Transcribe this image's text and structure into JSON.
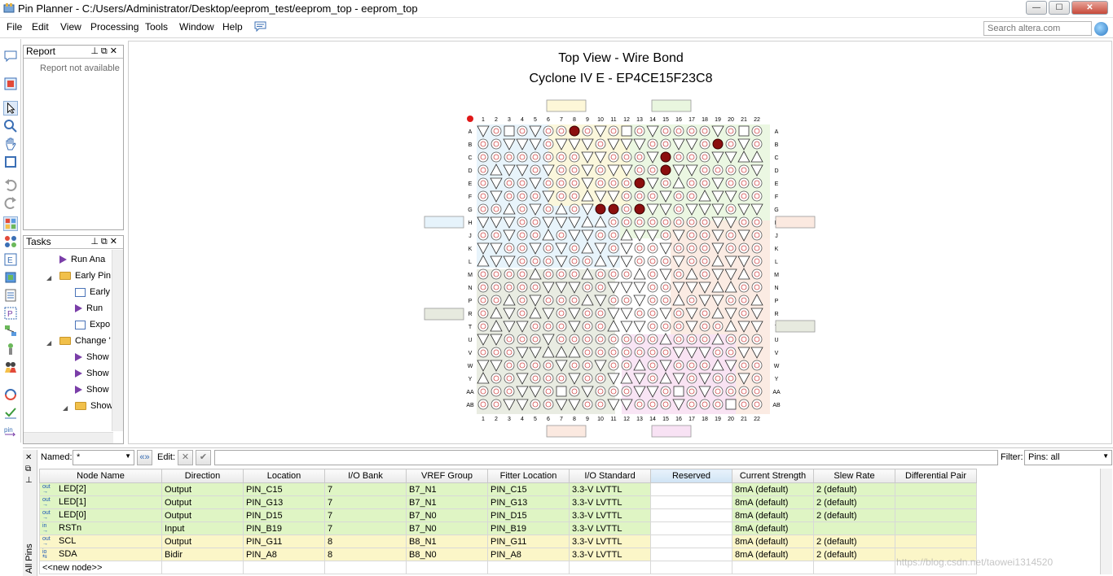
{
  "window": {
    "title": "Pin Planner - C:/Users/Administrator/Desktop/eeprom_test/eeprom_top - eeprom_top"
  },
  "menu": [
    "File",
    "Edit",
    "View",
    "Processing",
    "Tools",
    "Window",
    "Help"
  ],
  "search": {
    "placeholder": "Search altera.com"
  },
  "report_panel": {
    "title": "Report",
    "empty_text": "Report not available"
  },
  "tasks_panel": {
    "title": "Tasks",
    "items": [
      "Run Ana",
      "Early Pin",
      "Early",
      "Run",
      "Expo",
      "Change '",
      "Show",
      "Show",
      "Show",
      "Show"
    ]
  },
  "package_view": {
    "title": "Top View - Wire Bond",
    "subtitle": "Cyclone IV E - EP4CE15F23C8",
    "columns": [
      "1",
      "2",
      "3",
      "4",
      "5",
      "6",
      "7",
      "8",
      "9",
      "10",
      "11",
      "12",
      "13",
      "14",
      "15",
      "16",
      "17",
      "18",
      "19",
      "20",
      "21",
      "22"
    ],
    "rows": [
      "A",
      "B",
      "C",
      "D",
      "E",
      "F",
      "G",
      "H",
      "J",
      "K",
      "L",
      "M",
      "N",
      "P",
      "R",
      "T",
      "U",
      "V",
      "W",
      "Y",
      "AA",
      "AB"
    ]
  },
  "filter_bar": {
    "named_label": "Named:",
    "named_value": "*",
    "edit_label": "Edit:",
    "filter_label": "Filter:",
    "filter_value": "Pins: all"
  },
  "side_tab": {
    "label": "All Pins"
  },
  "pin_table": {
    "columns": [
      "Node Name",
      "Direction",
      "Location",
      "I/O Bank",
      "VREF Group",
      "Fitter Location",
      "I/O Standard",
      "Reserved",
      "Current Strength",
      "Slew Rate",
      "Differential Pair"
    ],
    "rows": [
      {
        "type": "out",
        "name": "LED[2]",
        "direction": "Output",
        "location": "PIN_C15",
        "bank": "7",
        "vref": "B7_N1",
        "fitter": "PIN_C15",
        "standard": "3.3-V LVTTL",
        "reserved": "",
        "current": "8mA (default)",
        "slew": "2 (default)",
        "diff": ""
      },
      {
        "type": "out",
        "name": "LED[1]",
        "direction": "Output",
        "location": "PIN_G13",
        "bank": "7",
        "vref": "B7_N1",
        "fitter": "PIN_G13",
        "standard": "3.3-V LVTTL",
        "reserved": "",
        "current": "8mA (default)",
        "slew": "2 (default)",
        "diff": ""
      },
      {
        "type": "out",
        "name": "LED[0]",
        "direction": "Output",
        "location": "PIN_D15",
        "bank": "7",
        "vref": "B7_N0",
        "fitter": "PIN_D15",
        "standard": "3.3-V LVTTL",
        "reserved": "",
        "current": "8mA (default)",
        "slew": "2 (default)",
        "diff": ""
      },
      {
        "type": "in",
        "name": "RSTn",
        "direction": "Input",
        "location": "PIN_B19",
        "bank": "7",
        "vref": "B7_N0",
        "fitter": "PIN_B19",
        "standard": "3.3-V LVTTL",
        "reserved": "",
        "current": "8mA (default)",
        "slew": "",
        "diff": ""
      },
      {
        "type": "out",
        "name": "SCL",
        "direction": "Output",
        "location": "PIN_G11",
        "bank": "8",
        "vref": "B8_N1",
        "fitter": "PIN_G11",
        "standard": "3.3-V LVTTL",
        "reserved": "",
        "current": "8mA (default)",
        "slew": "2 (default)",
        "diff": ""
      },
      {
        "type": "io",
        "name": "SDA",
        "direction": "Bidir",
        "location": "PIN_A8",
        "bank": "8",
        "vref": "B8_N0",
        "fitter": "PIN_A8",
        "standard": "3.3-V LVTTL",
        "reserved": "",
        "current": "8mA (default)",
        "slew": "2 (default)",
        "diff": ""
      }
    ],
    "new_node": "<<new node>>"
  },
  "watermark": "https://blog.csdn.net/taowei1314520"
}
